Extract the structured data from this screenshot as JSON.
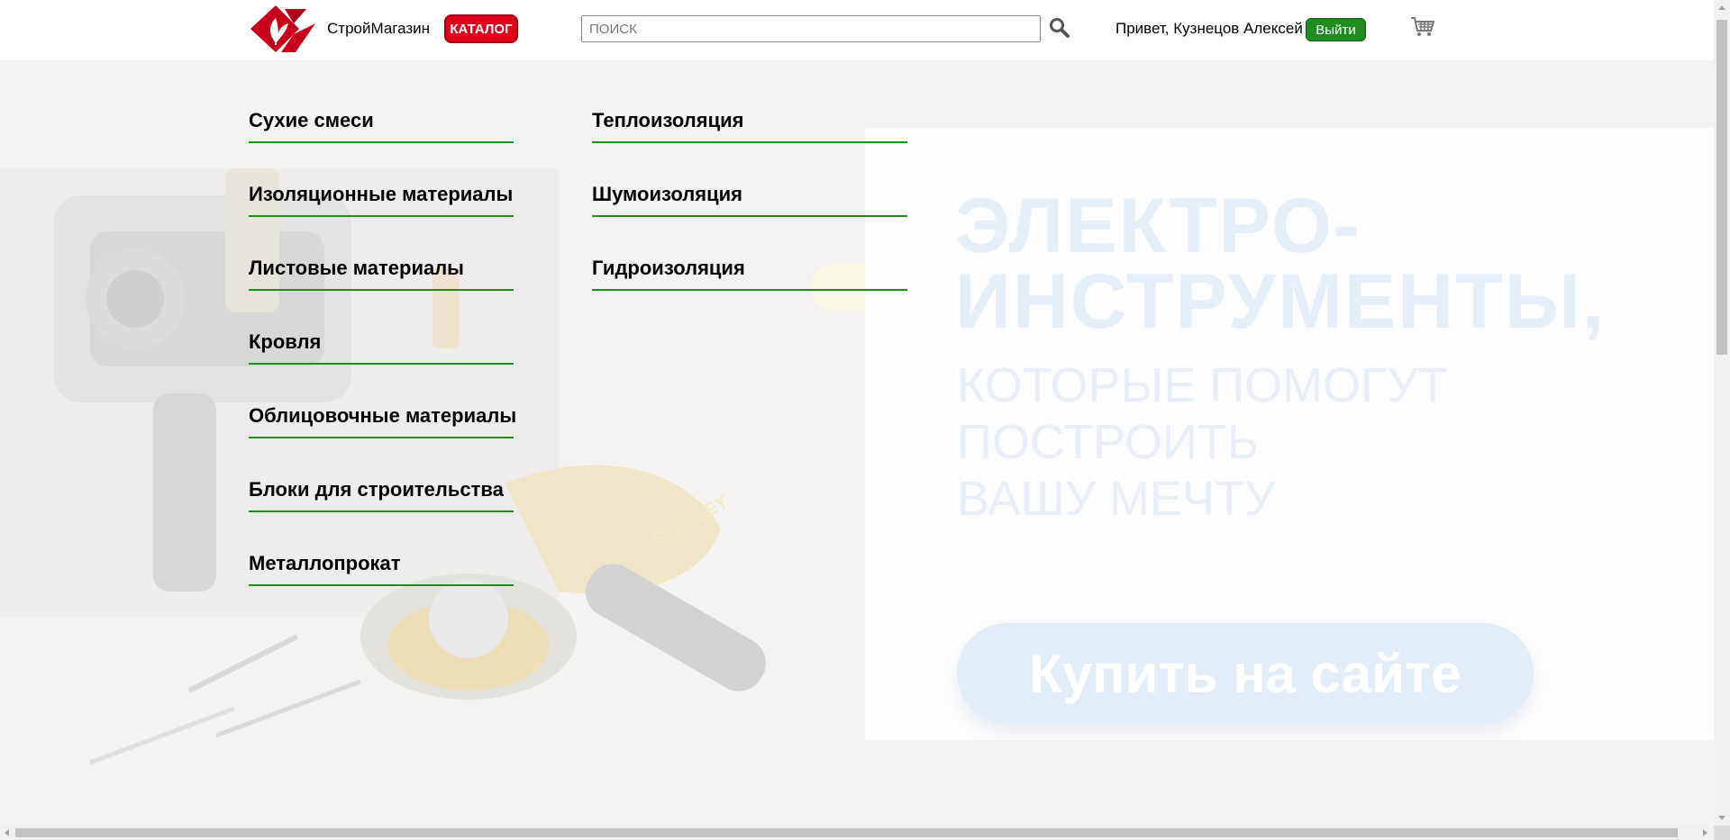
{
  "header": {
    "brand": "СтройМагазин",
    "catalog_label": "КАТАЛОГ",
    "search_placeholder": "ПОИСК",
    "greeting": "Привет, Кузнецов Алексей",
    "logout_label": "Выйти",
    "icons": {
      "logo": "logo-icon",
      "search": "search-icon",
      "cart": "cart-icon"
    },
    "colors": {
      "accent_red": "#e0001b",
      "accent_green": "#1f8c1f"
    }
  },
  "catalog": {
    "column1": [
      "Сухие смеси",
      "Изоляционные материалы",
      "Листовые материалы",
      "Кровля",
      "Облицовочные материалы",
      "Блоки для строительства",
      "Металлопрокат"
    ],
    "column2": [
      "Теплоизоляция",
      "Шумоизоляция",
      "Гидроизоляция"
    ]
  },
  "banner": {
    "headline_line1": "ЭЛЕКТРО-",
    "headline_line2": "ИНСТРУМЕНТЫ,",
    "sub_line1": "КОТОРЫЕ ПОМОГУТ",
    "sub_line2": "ПОСТРОИТЬ",
    "sub_line3": "ВАШУ МЕЧТУ",
    "cta_label": "Купить на сайте",
    "tool_brand": "STANLEY"
  }
}
